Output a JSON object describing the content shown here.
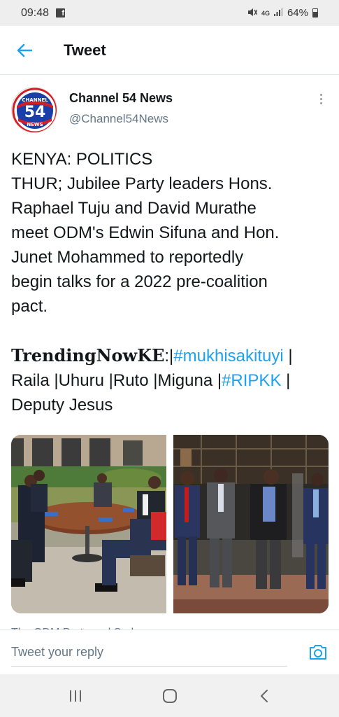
{
  "status_bar": {
    "time": "09:48",
    "battery": "64%",
    "network": "4G",
    "notification_icon": "facebook-icon"
  },
  "header": {
    "title": "Tweet",
    "back_icon": "arrow-left-icon"
  },
  "author": {
    "name": "Channel 54 News",
    "handle": "@Channel54News",
    "avatar_text_top": "CHANNEL",
    "avatar_number": "54",
    "avatar_text_bottom": "NEWS"
  },
  "tweet": {
    "line1": "KENYA: POLITICS",
    "line2": "THUR; Jubilee Party leaders Hons.",
    "line3": "Raphael Tuju and David Murathe",
    "line4": "meet ODM's Edwin Sifuna and Hon.",
    "line5": "Junet Mohammed to reportedly",
    "line6": "begin talks for a 2022 pre-coalition",
    "line7": "pact.",
    "brand": "TrendingNowKE",
    "brand_sep": ":|",
    "hashtag1": "#mukhisakituyi",
    "after_hashtag1": " |",
    "line10_a": "Raila |Uhuru |Ruto |Miguna |",
    "hashtag2": "#RIPKK",
    "after_hashtag2": " |",
    "line11": "Deputy Jesus"
  },
  "media": {
    "photo_count": 2
  },
  "peek_text": "The ODM Party and Sudan",
  "reply": {
    "placeholder": "Tweet your reply",
    "camera_icon": "camera-icon"
  },
  "nav": {
    "recents_icon": "recents-icon",
    "home_icon": "home-icon",
    "back_icon": "back-chevron-icon"
  },
  "colors": {
    "accent": "#1da1f2",
    "text": "#14171a",
    "secondary": "#657786",
    "brand_blue": "#1a3fa8",
    "brand_red": "#d11f26"
  }
}
